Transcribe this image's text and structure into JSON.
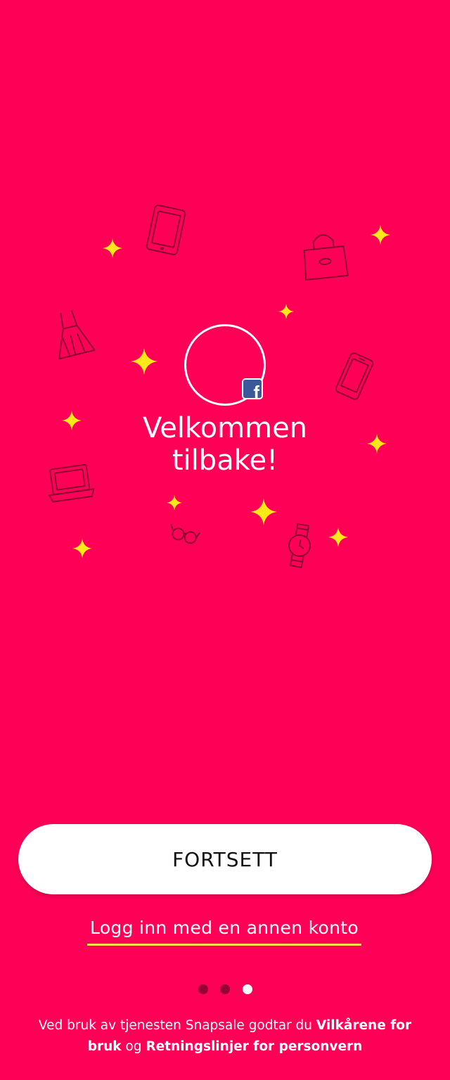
{
  "colors": {
    "background": "#ff0057",
    "sparkle": "#ffe81a",
    "outline_icons": "#8e0035",
    "underline": "#ffe24a",
    "facebook": "#3b5998",
    "dot_inactive": "#9a0038",
    "dot_active": "#ffffff"
  },
  "illustration": {
    "icons": [
      "tablet-icon",
      "handbag-icon",
      "dress-icon",
      "smartphone-icon",
      "laptop-icon",
      "glasses-icon",
      "wristwatch-icon"
    ],
    "sparkle_icon": "sparkle-icon"
  },
  "profile": {
    "avatar_icon": "avatar-circle",
    "badge_icon": "facebook-icon",
    "badge_glyph": "f"
  },
  "welcome": {
    "line1": "Velkommen",
    "line2": "tilbake!"
  },
  "actions": {
    "continue_label": "FORTSETT",
    "other_account_label": "Logg inn med en annen konto"
  },
  "pagination": {
    "total": 3,
    "active_index": 2
  },
  "terms": {
    "prefix": "Ved bruk av tjenesten Snapsale godtar du",
    "terms_link": "Vilkårene for bruk",
    "connector": "og",
    "privacy_link": "Retningslinjer for personvern"
  }
}
